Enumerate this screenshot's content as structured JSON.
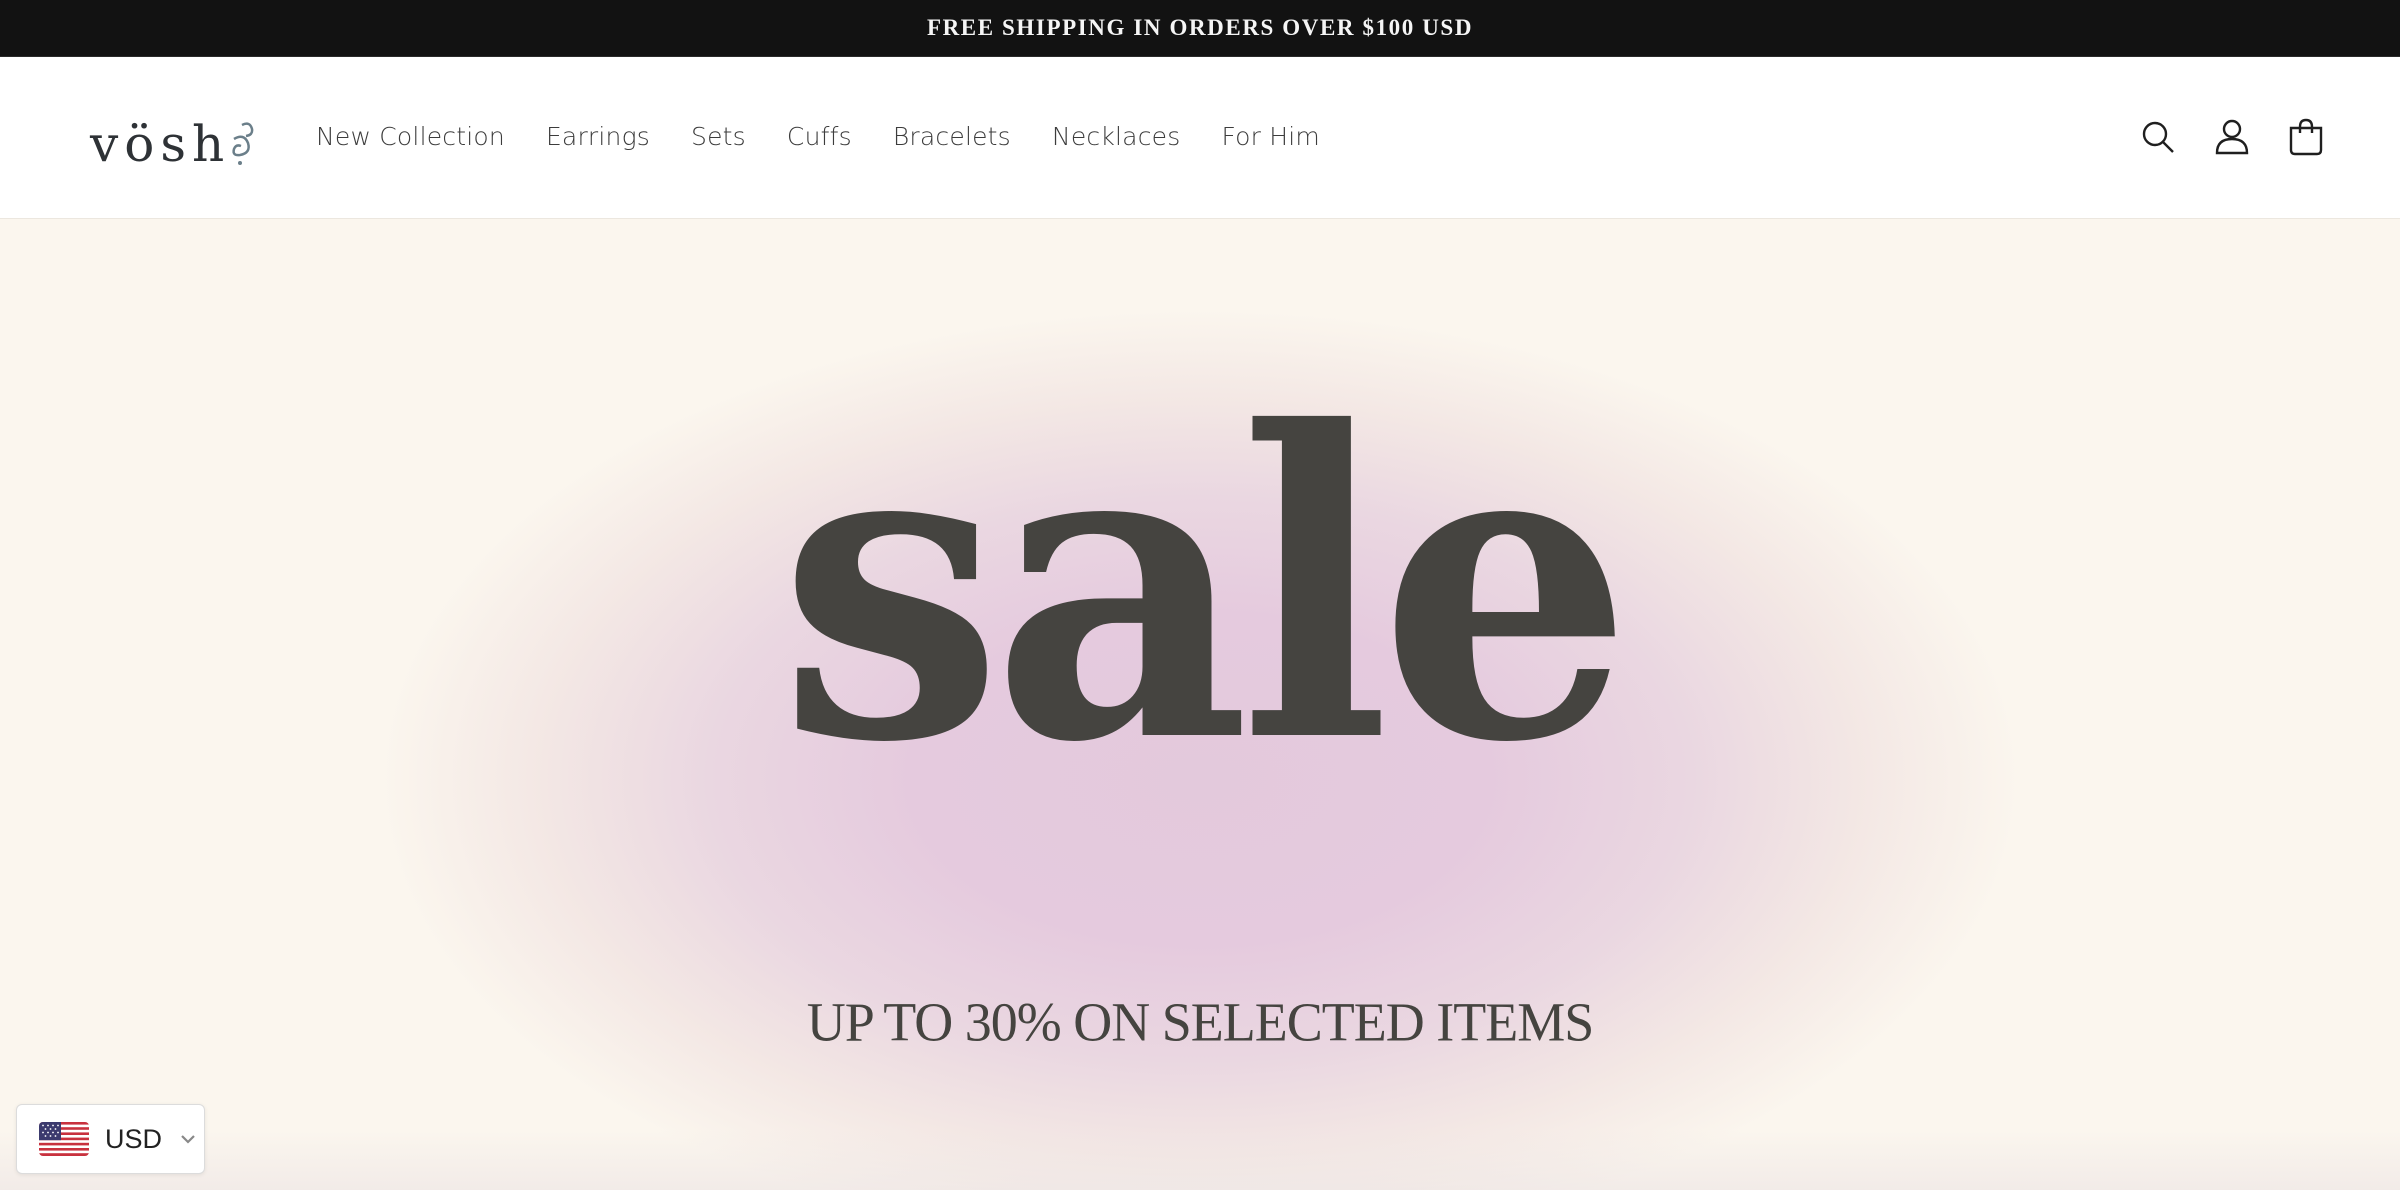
{
  "announcement": {
    "text": "FREE SHIPPING IN ORDERS OVER $100 USD"
  },
  "header": {
    "logo_text": "vösh",
    "nav": [
      {
        "label": "New Collection"
      },
      {
        "label": "Earrings"
      },
      {
        "label": "Sets"
      },
      {
        "label": "Cuffs"
      },
      {
        "label": "Bracelets"
      },
      {
        "label": "Necklaces"
      },
      {
        "label": "For Him"
      }
    ],
    "icons": [
      "search-icon",
      "account-icon",
      "cart-icon"
    ]
  },
  "hero": {
    "headline": "sale",
    "subheadline": "UP TO 30% ON SELECTED ITEMS"
  },
  "currency_selector": {
    "code": "USD",
    "flag": "us-flag-icon"
  },
  "colors": {
    "announcement_bg": "#121212",
    "hero_pink": "#e3c9dc",
    "hero_cream": "#fbf6ee",
    "text_dark": "#454440"
  }
}
